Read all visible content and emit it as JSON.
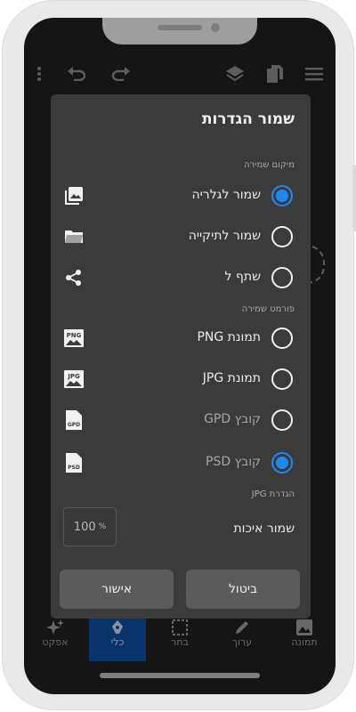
{
  "colors": {
    "accent": "#1e88f5",
    "dialog_bg": "#3b3b3b",
    "active_tab": "#0d4d9e"
  },
  "toolbar": {
    "icons": [
      "more-vert-icon",
      "undo-icon",
      "redo-icon",
      "layers-icon",
      "copy-icon",
      "menu-icon"
    ]
  },
  "dialog": {
    "title": "שמור הגדרות",
    "location_section": "מיקום שמירה",
    "location_options": [
      {
        "label": "שמור לגלריה",
        "selected": true,
        "icon": "gallery-icon"
      },
      {
        "label": "שמור לתיקייה",
        "selected": false,
        "icon": "folder-icon"
      },
      {
        "label": "שתף ל",
        "selected": false,
        "icon": "share-icon"
      }
    ],
    "format_section": "פורמט שמירה",
    "format_options": [
      {
        "label": "תמונת PNG",
        "selected": false,
        "dim": false,
        "icon": "png-file-icon",
        "icon_text": "PNG"
      },
      {
        "label": "תמונת JPG",
        "selected": false,
        "dim": false,
        "icon": "jpg-file-icon",
        "icon_text": "JPG"
      },
      {
        "label": "קובץ GPD",
        "selected": false,
        "dim": true,
        "icon": "gpd-file-icon",
        "icon_text": "GPD"
      },
      {
        "label": "קובץ PSD",
        "selected": true,
        "dim": true,
        "icon": "psd-file-icon",
        "icon_text": "PSD"
      }
    ],
    "jpg_section": "הגדרת JPG",
    "quality_label": "שמור איכות",
    "quality_value": "100",
    "quality_unit": "%",
    "cancel_label": "ביטול",
    "ok_label": "אישור"
  },
  "bottom_nav": [
    {
      "label": "תמונה",
      "icon": "image-icon",
      "active": false
    },
    {
      "label": "ערוך",
      "icon": "pencil-icon",
      "active": false
    },
    {
      "label": "בחר",
      "icon": "select-icon",
      "active": false
    },
    {
      "label": "כלי",
      "icon": "pen-tool-icon",
      "active": true
    },
    {
      "label": "אפקט",
      "icon": "sparkle-icon",
      "active": false
    }
  ]
}
